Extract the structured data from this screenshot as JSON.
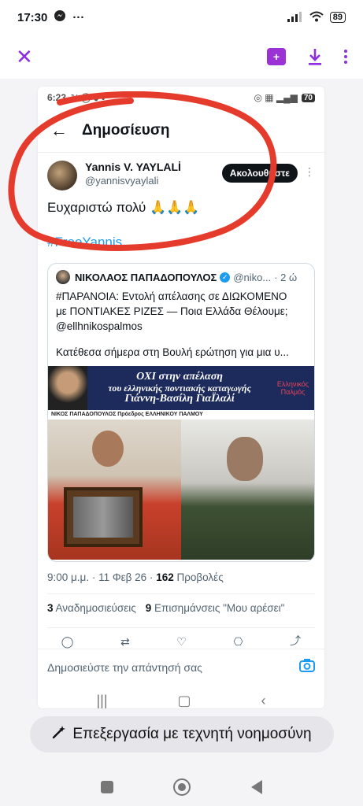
{
  "status_bar": {
    "time": "17:30",
    "messenger_icon": "messenger-icon",
    "more": "···",
    "battery": "89"
  },
  "viewer_toolbar": {
    "close_icon": "close-icon",
    "add_to_album_icon": "add-to-album-icon",
    "download_icon": "download-icon",
    "more_icon": "more-vert-icon",
    "accent_color": "#8e2de2"
  },
  "shot": {
    "inner_status": {
      "time": "6:23",
      "battery": "70"
    },
    "header": {
      "title": "Δημοσίευση"
    },
    "author": {
      "name": "Yannis V. YAYLALİ",
      "handle": "@yannisvyaylali",
      "follow_label": "Ακολουθήστε"
    },
    "post_text": "Ευχαριστώ πολύ 🙏🙏🙏",
    "hashtag": "#FreeYannis",
    "quote": {
      "name": "ΝΙΚΟΛΑΟΣ ΠΑΠΑΔΟΠΟΥΛΟΣ",
      "handle": "@niko...",
      "time": "· 2 ώ",
      "lines": [
        "#ΠΑΡΑΝΟΙΑ: Εντολή απέλασης σε ΔΙΩΚΟΜΕΝΟ",
        "με ΠΟΝΤΙΑΚΕΣ ΡΙΖΕΣ — Ποια Ελλάδα Θέλουμε;",
        "@ellhnikospalmos"
      ],
      "line_extra": "Κατέθεσα σήμερα στη Βουλή ερώτηση για μια υ...",
      "banner_line1": "ΟΧΙ στην απέλαση",
      "banner_line2": "του ελληνικής ποντιακής καταγωγής",
      "banner_line3": "Γιάννη-Βασίλη ΓιαΪλαλί",
      "banner_logo": "Ελληνικός Παλμός",
      "caption": "ΝΙΚΟΣ ΠΑΠΑΔΟΠΟΥΛΟΣ Πρόεδρος ΕΛΛΗΝΙΚΟΥ ΠΑΛΜΟΥ"
    },
    "meta": {
      "time_date": "9:00 μ.μ. · 11 Φεβ 26 ·",
      "views_count": "162",
      "views_label": "Προβολές"
    },
    "stats": {
      "reposts_count": "3",
      "reposts_label": "Αναδημοσιεύσεις",
      "likes_count": "9",
      "likes_label": "Επισημάνσεις \"Μου αρέσει\""
    },
    "reply_placeholder": "Δημοσιεύστε την απάντησή σας"
  },
  "ai_edit": {
    "label": "Επεξεργασία με τεχνητή νοημοσύνη",
    "icon": "magic-wand-icon"
  },
  "annotation_color": "#e53b2c"
}
